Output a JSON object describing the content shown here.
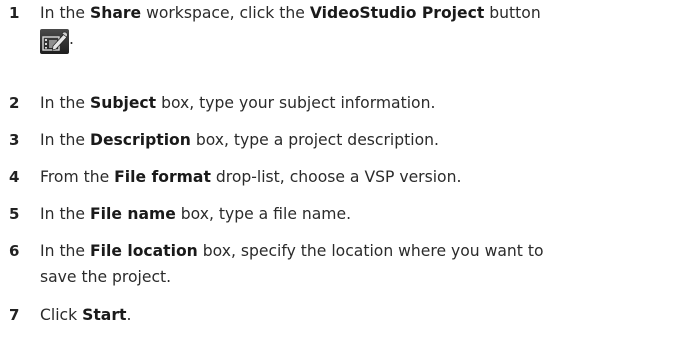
{
  "steps": [
    {
      "number": "1",
      "pre": "In the ",
      "b1": "Share",
      "mid1": " workspace, click the ",
      "b2": "VideoStudio Project",
      "post": " button",
      "icon": "videostudio-project-icon",
      "after_icon": "."
    },
    {
      "number": "2",
      "pre": "In the ",
      "b1": "Subject",
      "post": " box, type your subject information."
    },
    {
      "number": "3",
      "pre": "In the ",
      "b1": "Description",
      "post": " box, type a project description."
    },
    {
      "number": "4",
      "pre": "From the ",
      "b1": "File format",
      "post": " drop-list, choose a VSP version."
    },
    {
      "number": "5",
      "pre": "In the ",
      "b1": "File name",
      "post": " box, type a file name."
    },
    {
      "number": "6",
      "pre": "In the ",
      "b1": "File location",
      "post": " box, specify the location where you want to",
      "line2": "save the project."
    },
    {
      "number": "7",
      "pre": "Click ",
      "b1": "Start",
      "post": "."
    }
  ]
}
